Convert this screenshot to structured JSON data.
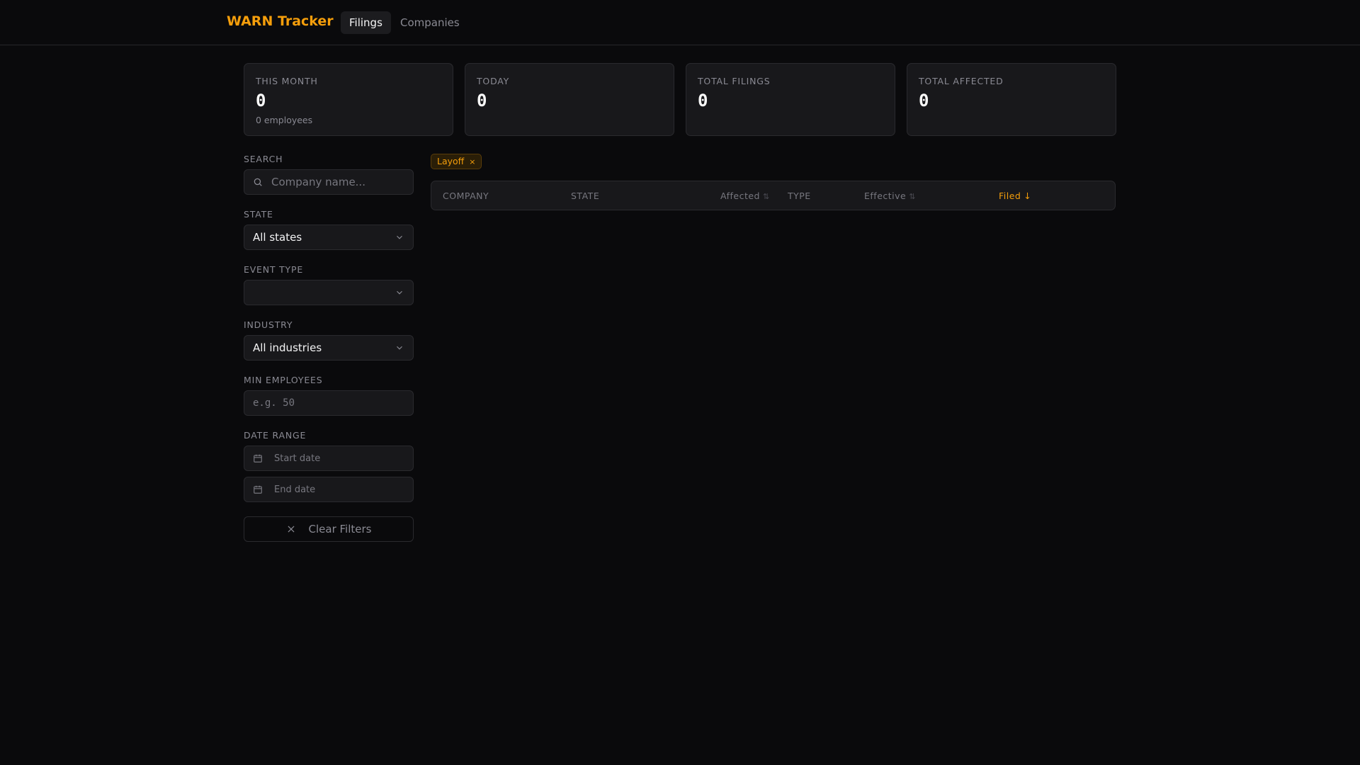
{
  "header": {
    "logo": "WARN Tracker",
    "tabs": [
      {
        "label": "Filings"
      },
      {
        "label": "Companies"
      }
    ]
  },
  "stats": [
    {
      "label": "THIS MONTH",
      "value": "0",
      "sub": "0 employees"
    },
    {
      "label": "TODAY",
      "value": "0"
    },
    {
      "label": "TOTAL FILINGS",
      "value": "0"
    },
    {
      "label": "TOTAL AFFECTED",
      "value": "0"
    }
  ],
  "filters": {
    "search": {
      "label": "SEARCH",
      "placeholder": "Company name..."
    },
    "state": {
      "label": "STATE",
      "value": "All states"
    },
    "event_type": {
      "label": "EVENT TYPE",
      "value": ""
    },
    "industry": {
      "label": "INDUSTRY",
      "value": "All industries"
    },
    "min_employees": {
      "label": "MIN EMPLOYEES",
      "placeholder": "e.g. 50"
    },
    "date_range": {
      "label": "DATE RANGE",
      "start_placeholder": "Start date",
      "end_placeholder": "End date"
    },
    "clear_label": "Clear Filters"
  },
  "active_chip": {
    "label": "Layoff",
    "remove": "×"
  },
  "table": {
    "columns": [
      {
        "label": "COMPANY"
      },
      {
        "label": "STATE"
      },
      {
        "label": "Affected",
        "sort": "⇅"
      },
      {
        "label": "TYPE"
      },
      {
        "label": "Effective",
        "sort": "⇅"
      },
      {
        "label": "Filed",
        "sort": "↓"
      }
    ]
  },
  "colors": {
    "accent": "#f59e0b",
    "bg": "#0a0a0c",
    "card": "#18181b"
  }
}
